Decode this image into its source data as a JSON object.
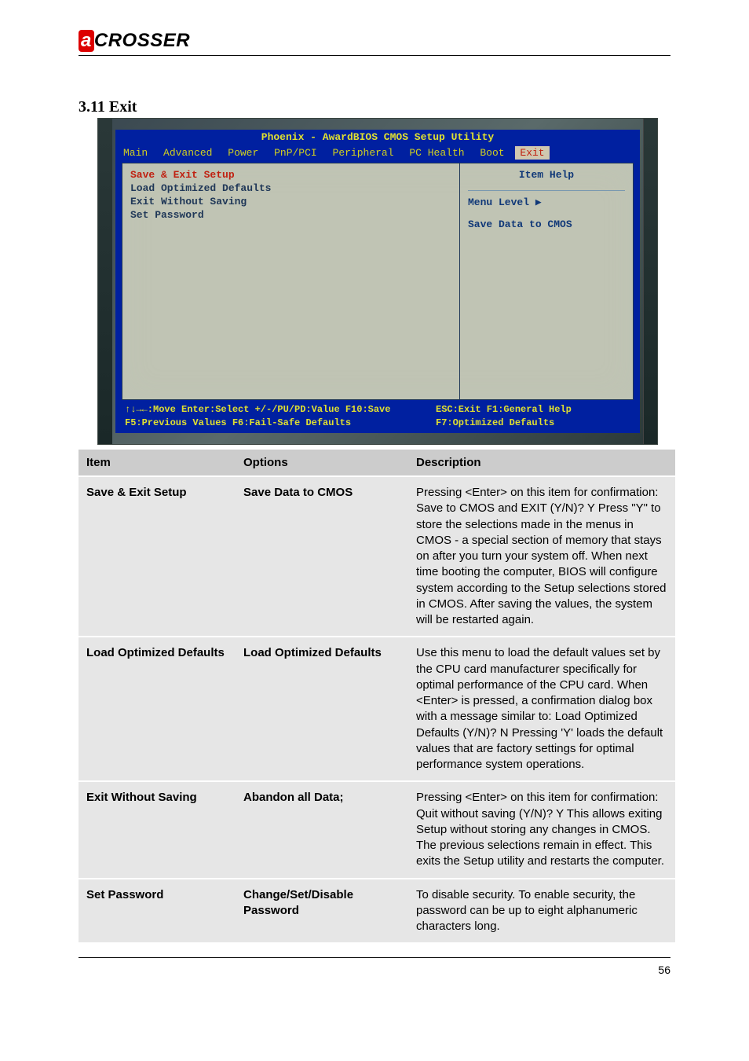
{
  "brand": {
    "prefix": "a",
    "rest": "CROSSER"
  },
  "section_title": "3.11 Exit",
  "bios": {
    "title": "Phoenix - AwardBIOS CMOS Setup Utility",
    "menu": [
      "Main",
      "Advanced",
      "Power",
      "PnP/PCI",
      "Peripheral",
      "PC Health",
      "Boot",
      "Exit"
    ],
    "active_tab": "Exit",
    "left_items": [
      "Save & Exit Setup",
      "Load Optimized Defaults",
      "Exit Without Saving",
      "Set Password"
    ],
    "selected_item": "Save & Exit Setup",
    "help": {
      "title": "Item Help",
      "menu_level": "Menu Level   ▶",
      "desc": "Save Data to CMOS"
    },
    "footer": {
      "line1_left": "↑↓→←:Move  Enter:Select  +/-/PU/PD:Value  F10:Save",
      "line1_right": "ESC:Exit  F1:General Help",
      "line2_left": "F5:Previous Values    F6:Fail-Safe Defaults",
      "line2_right": "F7:Optimized Defaults"
    }
  },
  "table": {
    "headers": [
      "Item",
      "Options",
      "Description"
    ],
    "rows": [
      {
        "item": "Save & Exit Setup",
        "opt": "Save Data to CMOS",
        "desc": "Pressing <Enter> on this item for confirmation: Save to CMOS and EXIT (Y/N)? Y Press \"Y\" to store the selections made in the menus in CMOS - a special section of memory that stays on after you turn your system off. When next time booting the computer, BIOS will configure system according to the Setup selections stored in CMOS. After saving the values, the system will be restarted again."
      },
      {
        "item": "Load Optimized Defaults",
        "opt": "Load Optimized Defaults",
        "desc": "Use this menu to load the default values set by the CPU card manufacturer specifically for optimal performance of the CPU card. When <Enter> is pressed, a confirmation dialog box with a message similar to: Load Optimized Defaults (Y/N)? N Pressing 'Y' loads the default values that are factory settings for optimal performance system operations."
      },
      {
        "item": "Exit Without Saving",
        "opt": "Abandon all Data;",
        "desc": "Pressing <Enter> on this item for confirmation: Quit without saving (Y/N)? Y This allows exiting Setup without storing any changes in CMOS. The previous selections remain in effect. This exits the Setup utility and restarts the computer."
      },
      {
        "item": "Set Password",
        "opt": "Change/Set/Disable Password",
        "desc": "To disable security. To enable security, the password can be up to eight alphanumeric characters long."
      }
    ]
  },
  "page_number": "56"
}
